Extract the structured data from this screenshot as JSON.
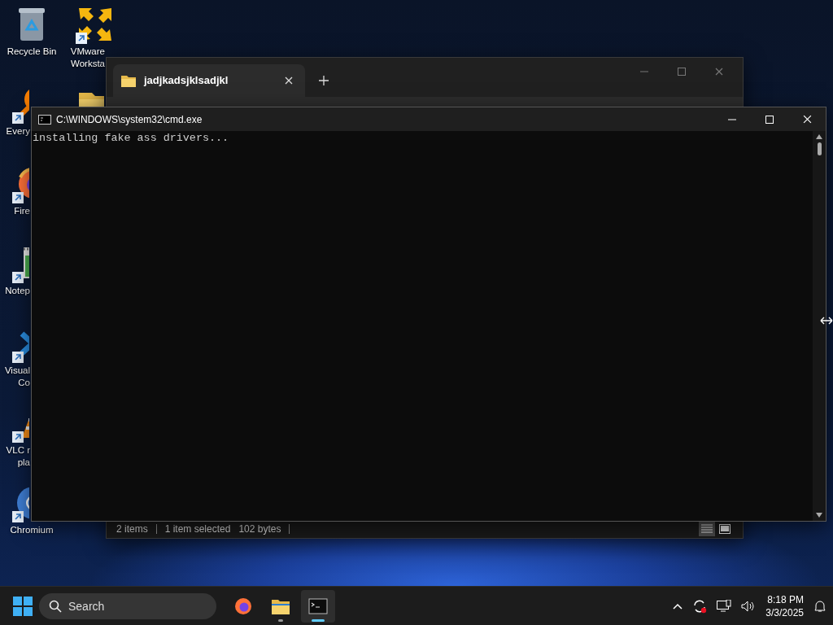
{
  "desktop_icons": [
    {
      "kind": "recycle",
      "label_lines": [
        "Recycle Bin"
      ],
      "shortcut": false
    },
    {
      "kind": "magnifier",
      "label_lines": [
        "Every"
      ],
      "shortcut": true
    },
    {
      "kind": "firefox",
      "label_lines": [
        "Fire"
      ],
      "shortcut": true
    },
    {
      "kind": "notepad",
      "label_lines": [
        "Notep"
      ],
      "shortcut": true
    },
    {
      "kind": "vscode",
      "label_lines": [
        "Visual",
        "Co"
      ],
      "shortcut": true
    },
    {
      "kind": "vlc",
      "label_lines": [
        "VLC r",
        "pla"
      ],
      "shortcut": true
    },
    {
      "kind": "chromium",
      "label_lines": [
        "Chromium"
      ],
      "shortcut": true
    },
    {
      "kind": "vmware",
      "label_lines": [
        "VMware",
        "Worksta"
      ],
      "shortcut": true
    },
    {
      "kind": "folder",
      "shortcut": false
    }
  ],
  "explorer": {
    "tabs": [
      {
        "label": "jadjkadsjklsadjkl",
        "selected": true
      }
    ],
    "status": {
      "item_count": "2 items",
      "selection": "1 item selected",
      "size": "102 bytes"
    },
    "views": [
      {
        "kind": "details",
        "selected": true
      },
      {
        "kind": "tiles",
        "selected": false
      }
    ]
  },
  "cmd": {
    "title": "C:\\WINDOWS\\system32\\cmd.exe",
    "output": [
      "installing fake ass drivers..."
    ]
  },
  "taskbar": {
    "search": {
      "placeholder": "Search"
    },
    "apps": [
      {
        "kind": "firefox",
        "open": false,
        "active": false
      },
      {
        "kind": "folder",
        "open": true,
        "active": false
      },
      {
        "kind": "terminal",
        "open": true,
        "active": true
      }
    ],
    "clock": {
      "time": "8:18 PM",
      "date": "3/3/2025"
    }
  }
}
